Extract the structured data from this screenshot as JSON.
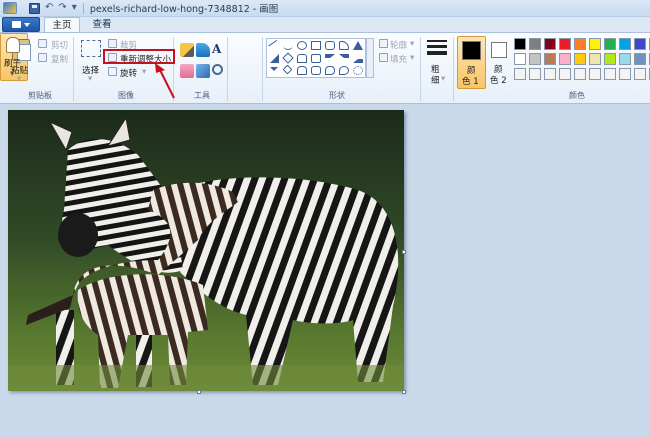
{
  "window": {
    "title": "pexels-richard-low-hong-7348812 - 画图",
    "qa_undo": "↶",
    "qa_redo": "↷",
    "qa_more": "▾"
  },
  "tabs": [
    {
      "label": "主页",
      "active": true
    },
    {
      "label": "查看",
      "active": false
    }
  ],
  "ribbon": {
    "clipboard": {
      "paste": "粘贴",
      "cut": "剪切",
      "copy": "复制",
      "group": "剪贴板"
    },
    "image": {
      "select": "选择",
      "crop": "裁剪",
      "resize": "重新调整大小",
      "rotate": "旋转",
      "group": "图像"
    },
    "tools": {
      "group": "工具",
      "text_tool": "A"
    },
    "brush": {
      "label": "刷子"
    },
    "shapes": {
      "outline": "轮廓",
      "fill": "填充",
      "group": "形状"
    },
    "size": {
      "label_1": "粗",
      "label_2": "细"
    },
    "colors": {
      "color1_a": "颜",
      "color1_b": "色 1",
      "color2_a": "颜",
      "color2_b": "色 2",
      "group": "颜色",
      "palette": [
        "#000000",
        "#7f7f7f",
        "#880015",
        "#ed1c24",
        "#ff7f27",
        "#fff200",
        "#22b14c",
        "#00a2e8",
        "#3f48cc",
        "#a349a4",
        "#ffffff",
        "#c3c3c3",
        "#b97a57",
        "#ffaec9",
        "#ffc90e",
        "#efe4b0",
        "#b5e61d",
        "#99d9ea",
        "#7092be",
        "#c8bfe7",
        "#f4f4f4",
        "#f4f4f4",
        "#f4f4f4",
        "#f4f4f4",
        "#f4f4f4",
        "#f4f4f4",
        "#f4f4f4",
        "#f4f4f4",
        "#f4f4f4",
        "#f4f4f4"
      ]
    }
  },
  "canvas": {
    "image_description_icon": "zebra-photo"
  }
}
